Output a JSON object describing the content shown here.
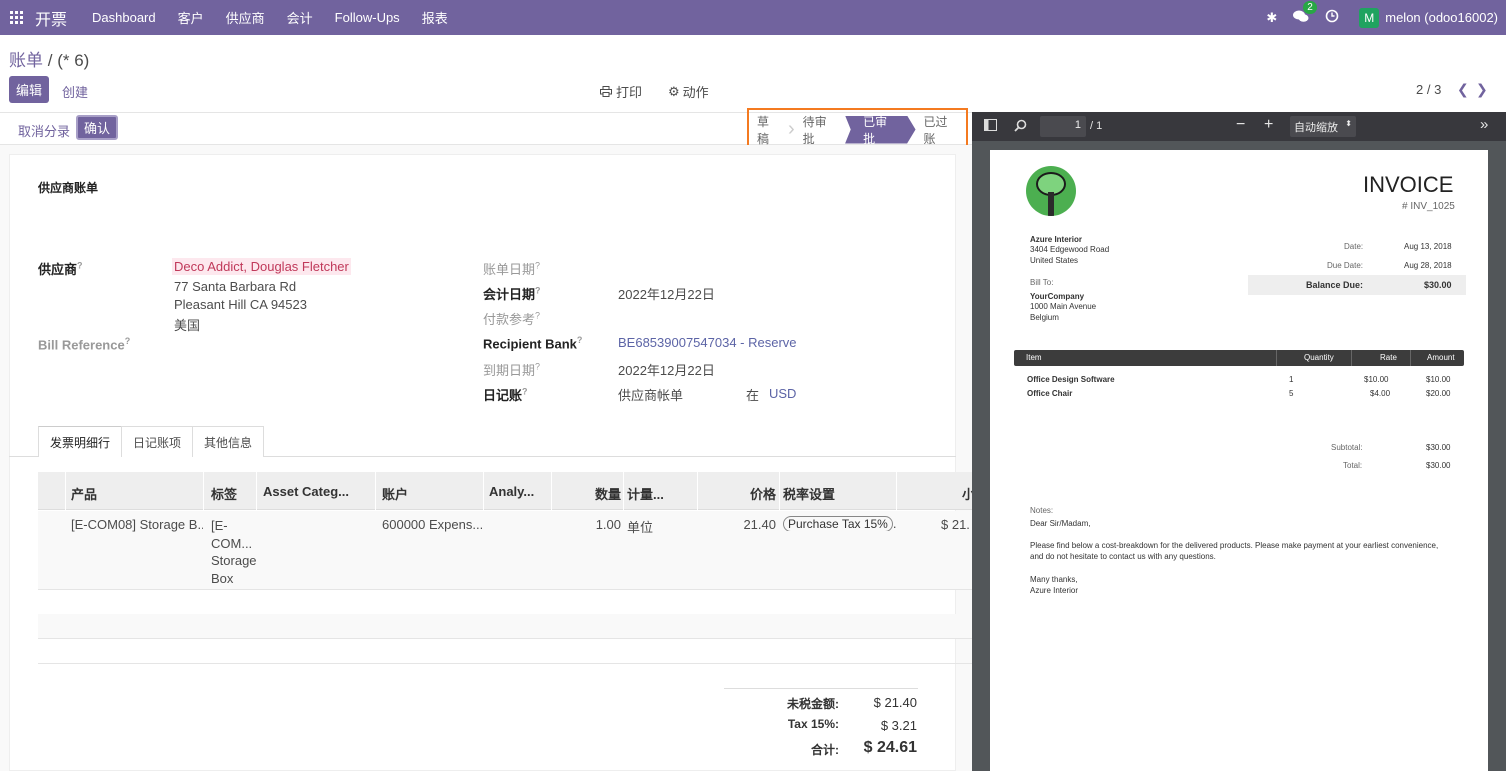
{
  "navbar": {
    "app_name": "开票",
    "menu": [
      "Dashboard",
      "客户",
      "供应商",
      "会计",
      "Follow-Ups",
      "报表"
    ],
    "chat_count": "2",
    "avatar_letter": "M",
    "user": "melon (odoo16002)"
  },
  "breadcrumb": {
    "parent": "账单",
    "sep": "/",
    "current": "(* 6)"
  },
  "toolbar": {
    "edit": "编辑",
    "create": "创建",
    "print": "打印",
    "action": "动作"
  },
  "pager": {
    "value": "2 / 3"
  },
  "statusbar": {
    "unreconcile": "取消分录",
    "confirm": "确认",
    "stages": [
      "草稿",
      "待审批",
      "已审批",
      "已过账"
    ],
    "active_stage": "已审批"
  },
  "form": {
    "title": "供应商账单",
    "vendor_label": "供应商",
    "vendor_name": "Deco Addict, Douglas Fletcher",
    "vendor_addr1": "77 Santa Barbara Rd",
    "vendor_addr2": "Pleasant Hill CA 94523",
    "vendor_country": "美国",
    "bill_ref_label": "Bill Reference",
    "bill_date_label": "账单日期",
    "acct_date_label": "会计日期",
    "acct_date": "2022年12月22日",
    "payment_ref_label": "付款参考",
    "recipient_bank_label": "Recipient Bank",
    "recipient_bank": "BE68539007547034 - Reserve",
    "due_date_label": "到期日期",
    "due_date": "2022年12月22日",
    "journal_label": "日记账",
    "journal": "供应商帐单",
    "in_label": "在",
    "currency": "USD",
    "help": "?"
  },
  "tabs": [
    "发票明细行",
    "日记账项",
    "其他信息"
  ],
  "table": {
    "headers": [
      "产品",
      "标签",
      "Asset Categ...",
      "账户",
      "Analy...",
      "数量",
      "计量...",
      "价格",
      "税率设置",
      "小"
    ],
    "row": {
      "product": "[E-COM08] Storage B...",
      "label_lines": [
        "[E-",
        "COM...",
        "Storage",
        "Box"
      ],
      "account": "600000 Expens...",
      "qty": "1.00",
      "uom": "单位",
      "price": "21.40",
      "tax": "Purchase Tax 15%",
      "tax_more": ".",
      "subtotal": "$ 21."
    }
  },
  "totals": {
    "untaxed_label": "未税金额:",
    "untaxed": "$ 21.40",
    "tax_label": "Tax 15%:",
    "tax": "$ 3.21",
    "total_label": "合计:",
    "total": "$ 24.61"
  },
  "pdf": {
    "page_num": "1",
    "page_total": "/ 1",
    "zoom": "自动缩放",
    "title": "INVOICE",
    "number": "# INV_1025",
    "from_name": "Azure Interior",
    "from_addr1": "3404 Edgewood Road",
    "from_addr2": "United States",
    "date_label": "Date:",
    "date": "Aug 13, 2018",
    "due_label": "Due Date:",
    "due": "Aug 28, 2018",
    "bill_to_label": "Bill To:",
    "to_name": "YourCompany",
    "to_addr1": "1000 Main Avenue",
    "to_addr2": "Belgium",
    "balance_label": "Balance Due:",
    "balance": "$30.00",
    "col_item": "Item",
    "col_qty": "Quantity",
    "col_rate": "Rate",
    "col_amount": "Amount",
    "items": [
      {
        "name": "Office Design Software",
        "qty": "1",
        "rate": "$10.00",
        "amount": "$10.00"
      },
      {
        "name": "Office Chair",
        "qty": "5",
        "rate": "$4.00",
        "amount": "$20.00"
      }
    ],
    "subtotal_label": "Subtotal:",
    "subtotal": "$30.00",
    "total_label": "Total:",
    "total": "$30.00",
    "notes_label": "Notes:",
    "greeting": "Dear Sir/Madam,",
    "note_line1": "Please find below a cost-breakdown for the delivered products. Please make payment at your earliest convenience,",
    "note_line2": "and do not hesitate to contact us with any questions.",
    "thanks": "Many thanks,",
    "signoff": "Azure Interior"
  },
  "colors": {
    "brand": "#71639e",
    "highlight": "#f47a20",
    "badge": "#28a745"
  }
}
